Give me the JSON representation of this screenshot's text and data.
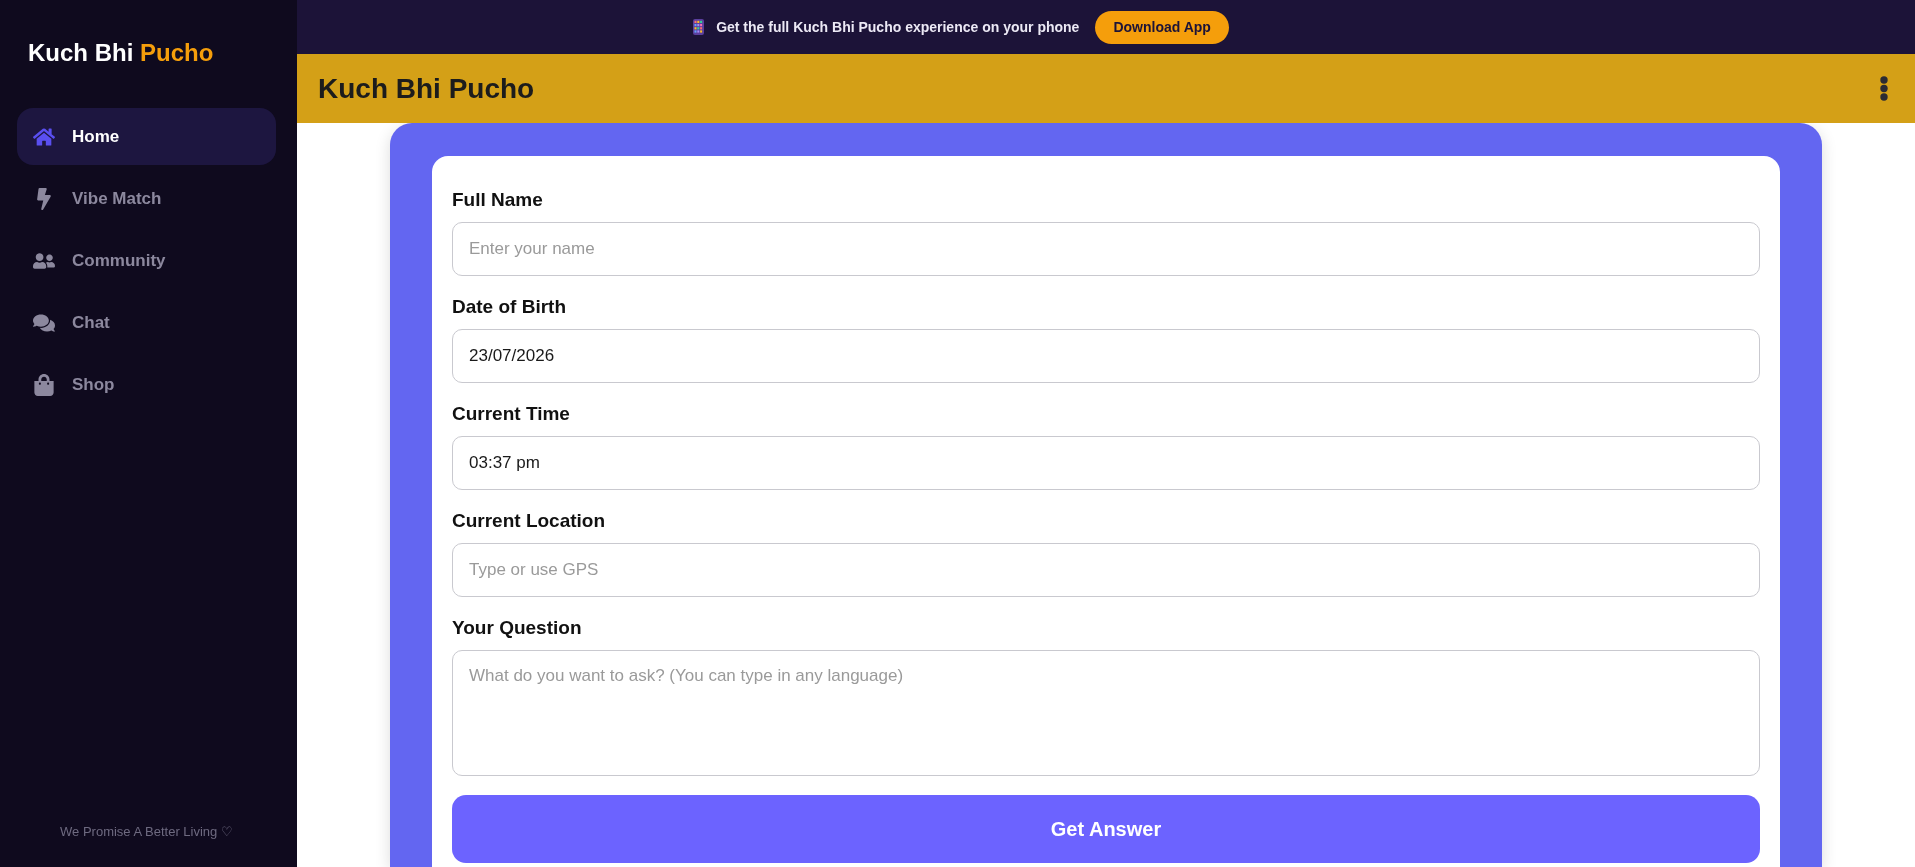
{
  "banner": {
    "message": "Get the full Kuch Bhi Pucho experience on your phone",
    "button": "Download App"
  },
  "sidebar": {
    "logo": {
      "text": "Kuch Bhi",
      "accent": "Pucho"
    },
    "items": [
      {
        "label": "Home",
        "selected": true
      },
      {
        "label": "Vibe Match",
        "selected": false
      },
      {
        "label": "Community",
        "selected": false
      },
      {
        "label": "Chat",
        "selected": false
      },
      {
        "label": "Shop",
        "selected": false
      }
    ],
    "footer": "We Promise A Better Living ♡"
  },
  "header": {
    "title": "Kuch Bhi Pucho"
  },
  "form": {
    "fields": [
      {
        "label": "Full Name",
        "kind": "text",
        "placeholder": "Enter your name"
      },
      {
        "label": "Date of Birth",
        "kind": "text",
        "value": "23/07/2026"
      },
      {
        "label": "Current Time",
        "kind": "text",
        "value": "03:37 pm"
      },
      {
        "label": "Current Location",
        "kind": "text",
        "placeholder": "Type or use GPS"
      },
      {
        "label": "Your Question",
        "kind": "textarea",
        "placeholder": "What do you want to ask? (You can type in any language)"
      }
    ],
    "submit": "Get Answer"
  }
}
